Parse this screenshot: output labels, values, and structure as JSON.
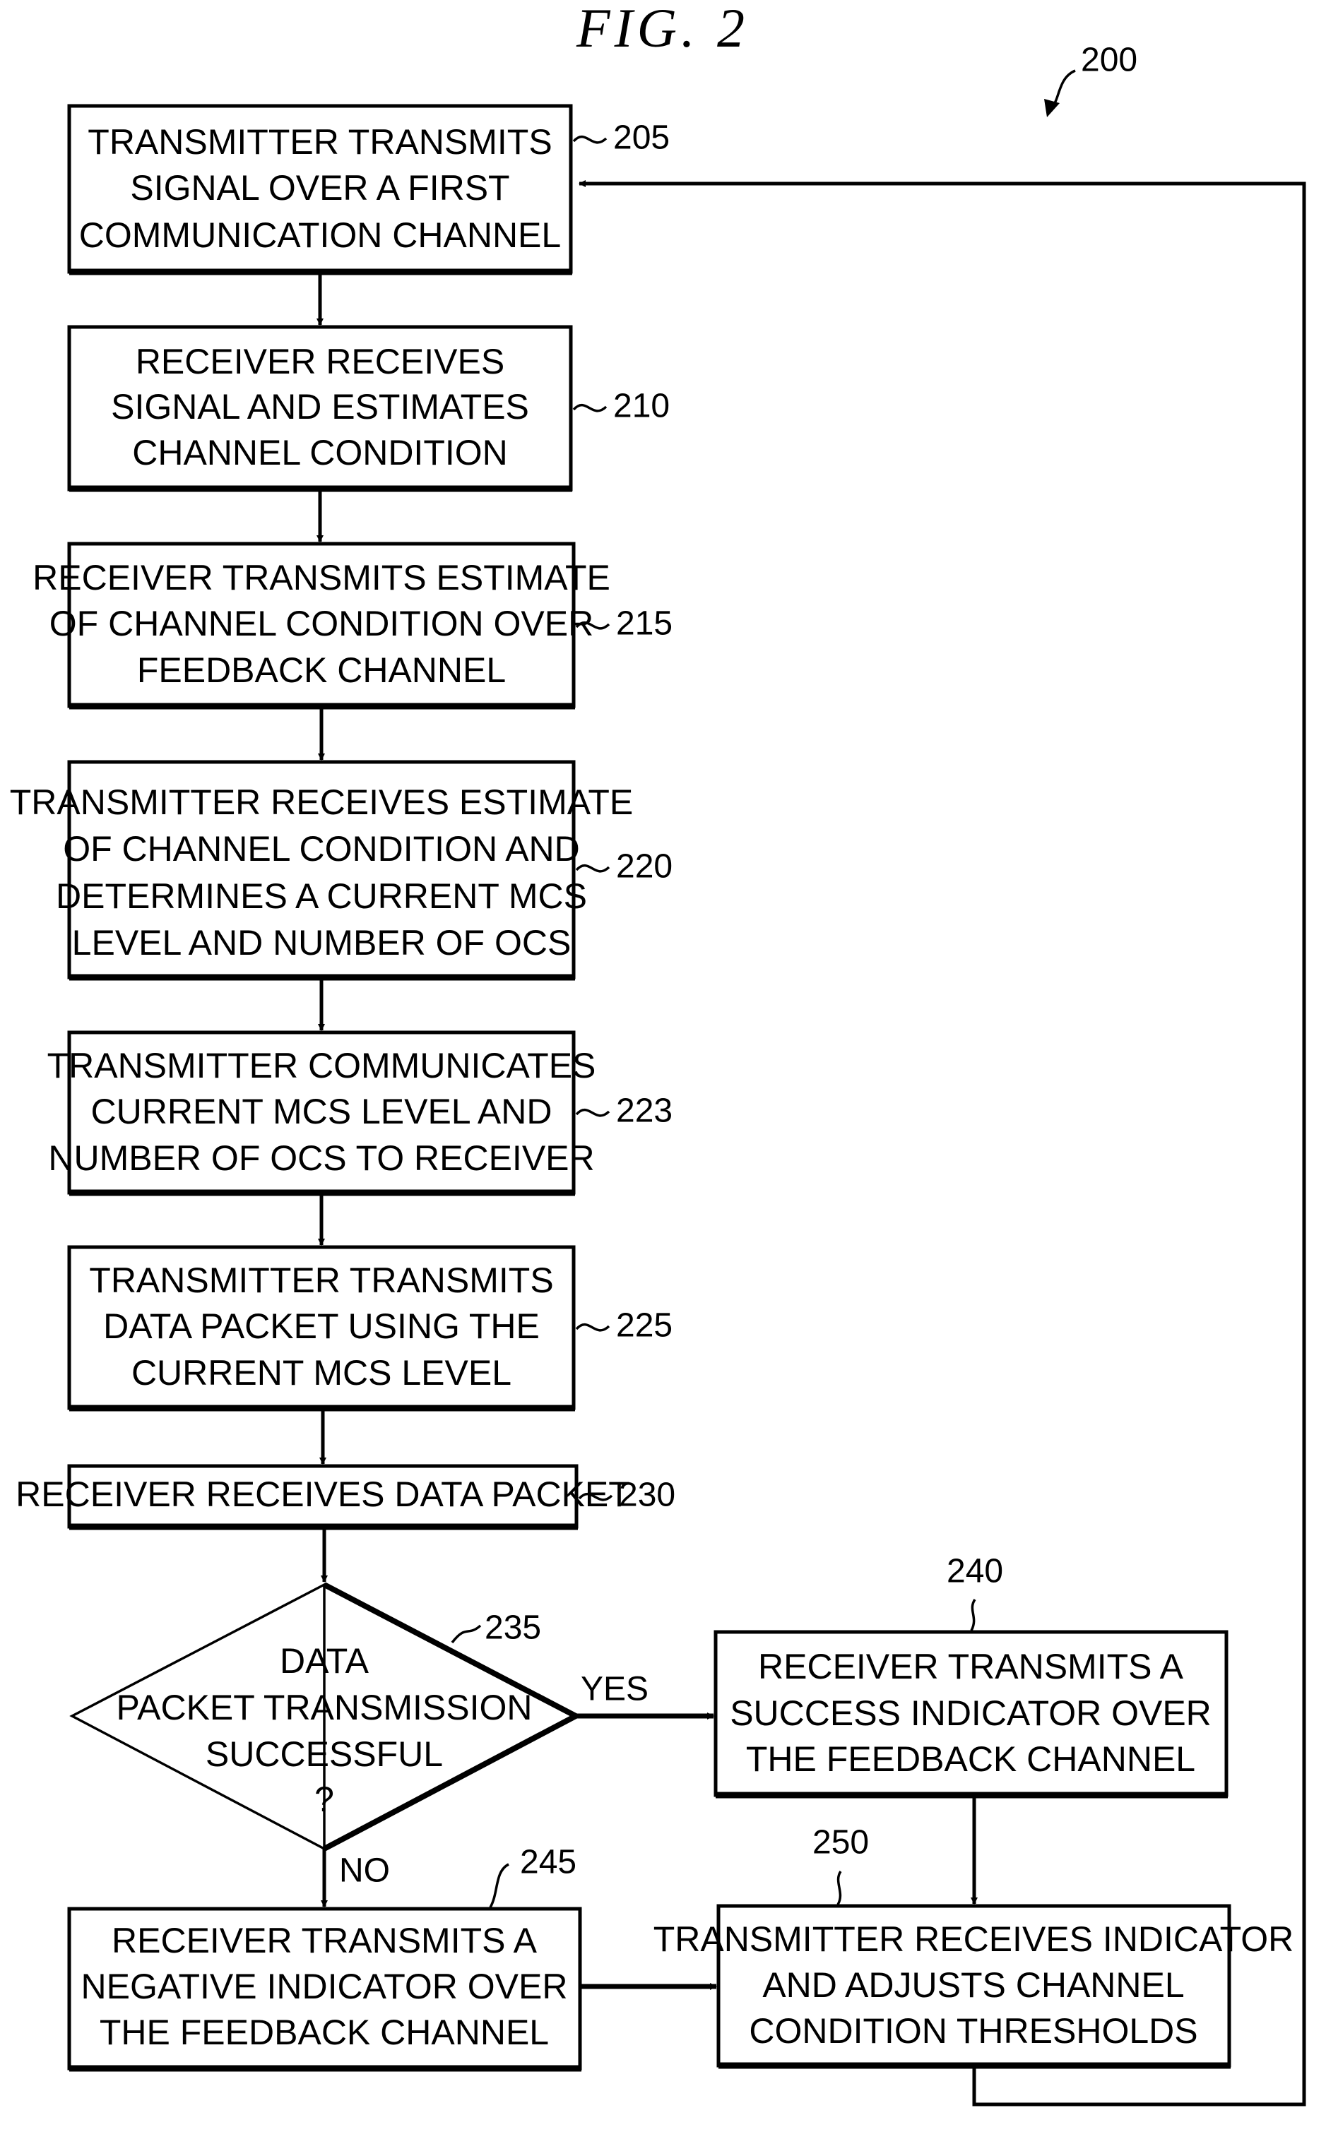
{
  "figure": {
    "title": "FIG.  2",
    "reference": "200"
  },
  "steps": [
    {
      "id": "205",
      "lines": [
        "TRANSMITTER TRANSMITS",
        "SIGNAL OVER A FIRST",
        "COMMUNICATION CHANNEL"
      ]
    },
    {
      "id": "210",
      "lines": [
        "RECEIVER RECEIVES",
        "SIGNAL AND ESTIMATES",
        "CHANNEL CONDITION"
      ]
    },
    {
      "id": "215",
      "lines": [
        "RECEIVER TRANSMITS ESTIMATE",
        "OF CHANNEL CONDITION OVER",
        "FEEDBACK CHANNEL"
      ]
    },
    {
      "id": "220",
      "lines": [
        "TRANSMITTER RECEIVES ESTIMATE",
        "OF CHANNEL CONDITION AND",
        "DETERMINES A CURRENT MCS",
        "LEVEL AND NUMBER OF OCS"
      ]
    },
    {
      "id": "223",
      "lines": [
        "TRANSMITTER COMMUNICATES",
        "CURRENT MCS LEVEL AND",
        "NUMBER OF OCS TO RECEIVER"
      ]
    },
    {
      "id": "225",
      "lines": [
        "TRANSMITTER TRANSMITS",
        "DATA PACKET USING THE",
        "CURRENT MCS LEVEL"
      ]
    },
    {
      "id": "230",
      "lines": [
        "RECEIVER RECEIVES DATA PACKET"
      ]
    }
  ],
  "decision": {
    "id": "235",
    "lines": [
      "DATA",
      "PACKET TRANSMISSION",
      "SUCCESSFUL",
      "?"
    ],
    "yes_label": "YES",
    "no_label": "NO"
  },
  "outcomes": [
    {
      "id": "240",
      "lines": [
        "RECEIVER TRANSMITS A",
        "SUCCESS INDICATOR OVER",
        "THE FEEDBACK CHANNEL"
      ]
    },
    {
      "id": "245",
      "lines": [
        "RECEIVER TRANSMITS A",
        "NEGATIVE INDICATOR OVER",
        "THE FEEDBACK CHANNEL"
      ]
    },
    {
      "id": "250",
      "lines": [
        "TRANSMITTER RECEIVES INDICATOR",
        "AND ADJUSTS CHANNEL",
        "CONDITION THRESHOLDS"
      ]
    }
  ]
}
